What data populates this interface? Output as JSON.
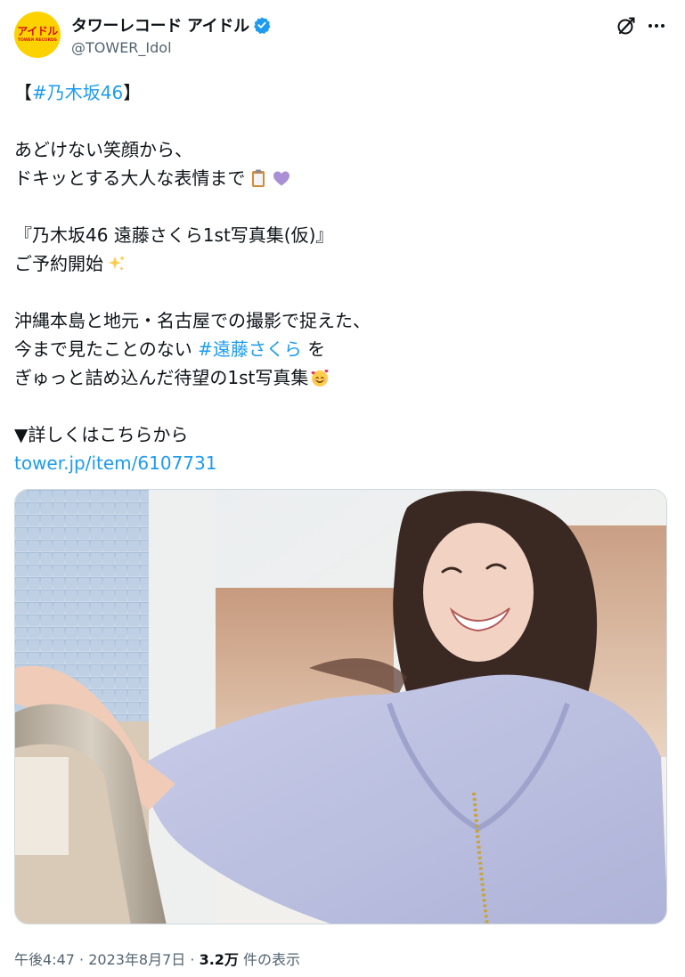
{
  "author": {
    "avatar_text": "アイドル",
    "avatar_subtext": "TOWER RECORDS",
    "display_name": "タワーレコード アイドル",
    "handle": "@TOWER_Idol",
    "verified": true
  },
  "actions": {
    "grok_icon": "grok-icon",
    "more_icon": "more-icon"
  },
  "post": {
    "line1_open": "【",
    "line1_tag": "#乃木坂46",
    "line1_close": "】",
    "line2": "あどけない笑顔から、",
    "line3": "ドキッとする大人な表情まで",
    "line4": "『乃木坂46 遠藤さくら1st写真集(仮)』",
    "line5": "ご予約開始",
    "line6": "沖縄本島と地元・名古屋での撮影で捉えた、",
    "line7_before": "今まで見たことのない ",
    "line7_tag": "#遠藤さくら",
    "line7_after": " を",
    "line8": "ぎゅっと詰め込んだ待望の1st写真集",
    "line9": "▼詳しくはこちらから",
    "link": "tower.jp/item/6107731"
  },
  "emojis": [
    "clipboard-emoji",
    "purple-heart-emoji",
    "sparkles-emoji",
    "smiling-face-with-hearts-emoji"
  ],
  "media": {
    "alt": "photo"
  },
  "meta": {
    "time": "午後4:47",
    "sep1": " · ",
    "date": "2023年8月7日",
    "sep2": " · ",
    "views": "3.2万",
    "views_label": " 件の表示"
  },
  "colors": {
    "link": "#1d9bf0",
    "secondary": "#536471",
    "avatar_bg": "#fcd200",
    "avatar_text": "#d6101c"
  }
}
